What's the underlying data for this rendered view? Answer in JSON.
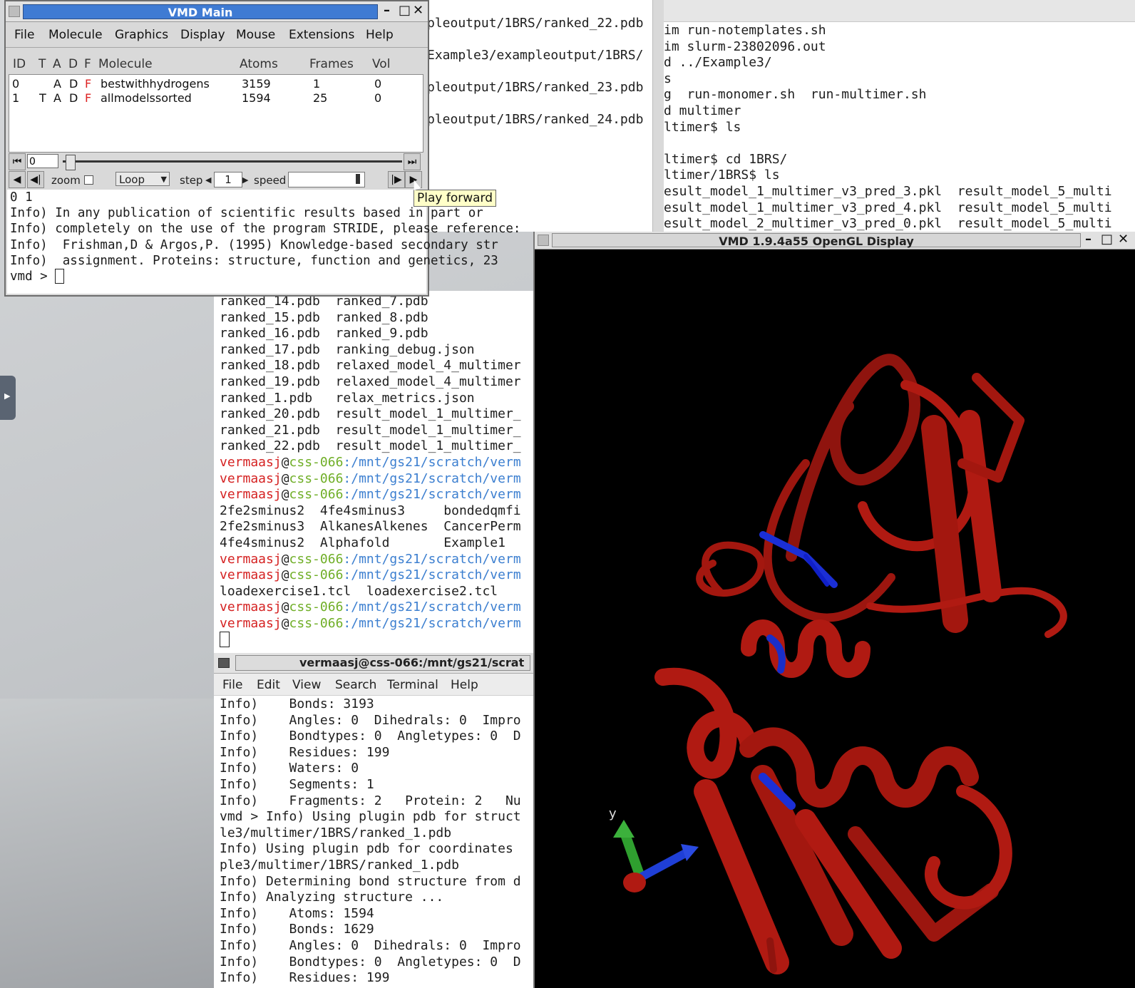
{
  "colors": {
    "username": "#d52222",
    "host": "#6fae26",
    "path": "#3c7fd0",
    "directory": "#1060d8",
    "protein": "#b01a12",
    "highlight": "#1020c8"
  },
  "term_topmid": {
    "lines": [
      "pleoutput/1BRS/ranked_22.pdb",
      "Example3/exampleoutput/1BRS/",
      "pleoutput/1BRS/ranked_23.pdb",
      "pleoutput/1BRS/ranked_24.pdb"
    ]
  },
  "term_right": {
    "lines": [
      "im run-notemplates.sh",
      "im slurm-23802096.out",
      "d ../Example3/",
      "s",
      "g  run-monomer.sh  run-multimer.sh",
      "d multimer",
      "ltimer$ ls",
      "",
      "ltimer$ cd 1BRS/",
      "ltimer/1BRS$ ls",
      "esult_model_1_multimer_v3_pred_3.pkl  result_model_5_multi",
      "esult_model_1_multimer_v3_pred_4.pkl  result_model_5_multi",
      "esult_model_2_multimer_v3_pred_0.pkl  result_model_5_multi"
    ]
  },
  "term_mid": {
    "file_lines": [
      "ranked_14.pdb  ranked_7.pdb",
      "ranked_15.pdb  ranked_8.pdb",
      "ranked_16.pdb  ranked_9.pdb",
      "ranked_17.pdb  ranking_debug.json",
      "ranked_18.pdb  relaxed_model_4_multimer",
      "ranked_19.pdb  relaxed_model_4_multimer",
      "ranked_1.pdb   relax_metrics.json",
      "ranked_20.pdb  result_model_1_multimer_",
      "ranked_21.pdb  result_model_1_multimer_",
      "ranked_22.pdb  result_model_1_multimer_"
    ],
    "prompt_user": "vermaasj",
    "prompt_at": "@",
    "prompt_host": "css-066",
    "prompt_path": ":/mnt/gs21/scratch/verm",
    "dir_lines": [
      "2fe2sminus2  4fe4sminus3     bondedqmfi",
      "2fe2sminus3  AlkanesAlkenes  CancerPerm",
      "4fe4sminus2  Alphafold       Example1"
    ],
    "tcl_line": "loadexercise1.tcl  loadexercise2.tcl"
  },
  "term_bottom": {
    "title": "vermaasj@css-066:/mnt/gs21/scrat",
    "menu": [
      "File",
      "Edit",
      "View",
      "Search",
      "Terminal",
      "Help"
    ],
    "lines": [
      "Info)    Bonds: 3193",
      "Info)    Angles: 0  Dihedrals: 0  Impro",
      "Info)    Bondtypes: 0  Angletypes: 0  D",
      "Info)    Residues: 199",
      "Info)    Waters: 0",
      "Info)    Segments: 1",
      "Info)    Fragments: 2   Protein: 2   Nu",
      "vmd > Info) Using plugin pdb for struct",
      "le3/multimer/1BRS/ranked_1.pdb",
      "Info) Using plugin pdb for coordinates",
      "ple3/multimer/1BRS/ranked_1.pdb",
      "Info) Determining bond structure from d",
      "Info) Analyzing structure ...",
      "Info)    Atoms: 1594",
      "Info)    Bonds: 1629",
      "Info)    Angles: 0  Dihedrals: 0  Impro",
      "Info)    Bondtypes: 0  Angletypes: 0  D",
      "Info)    Residues: 199"
    ]
  },
  "vmd_main": {
    "title": "VMD Main",
    "menu": [
      "File",
      "Molecule",
      "Graphics",
      "Display",
      "Mouse",
      "Extensions",
      "Help"
    ],
    "columns": [
      "ID",
      "T",
      "A",
      "D",
      "F",
      "Molecule",
      "Atoms",
      "Frames",
      "Vol"
    ],
    "molecules": [
      {
        "id": "0",
        "t": "",
        "a": "A",
        "d": "D",
        "f": "F",
        "name": "bestwithhydrogens",
        "atoms": "3159",
        "frames": "1",
        "vol": "0"
      },
      {
        "id": "1",
        "t": "T",
        "a": "A",
        "d": "D",
        "f": "F",
        "name": "allmodelssorted",
        "atoms": "1594",
        "frames": "25",
        "vol": "0"
      }
    ],
    "frame_value": "0",
    "zoom_label": "zoom",
    "loop_value": "Loop",
    "step_label": "step",
    "step_value": "1",
    "speed_label": "speed",
    "console": [
      "0 1",
      "Info) In any publication of scientific results based in part or",
      "Info) completely on the use of the program STRIDE, please reference:",
      "Info)  Frishman,D & Argos,P. (1995) Knowledge-based secondary str",
      "Info)  assignment. Proteins: structure, function and genetics, 23"
    ],
    "prompt": "vmd > "
  },
  "tooltip": "Play forward",
  "gl_display": {
    "title": "VMD 1.9.4a55 OpenGL Display",
    "axis_label": "y"
  }
}
